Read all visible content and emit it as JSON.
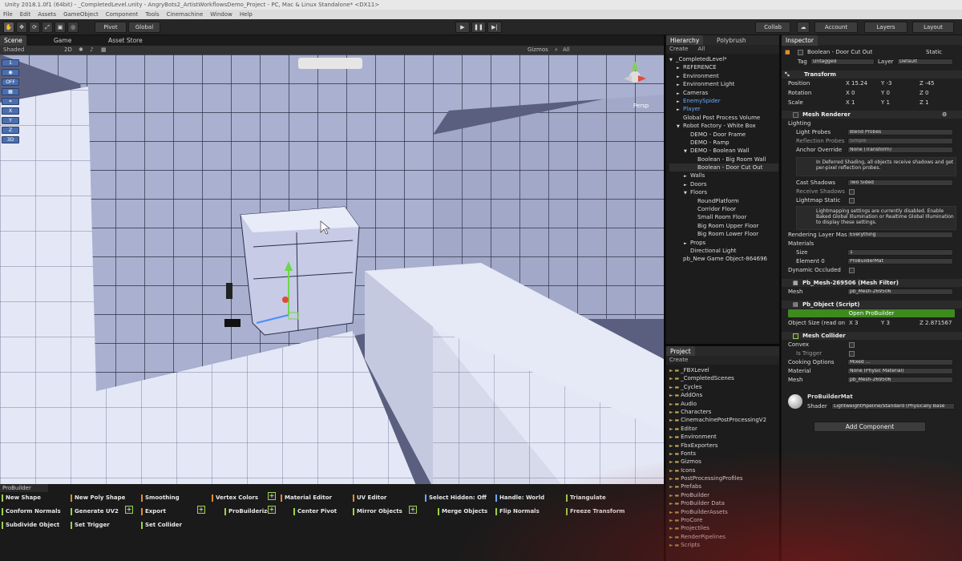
{
  "window": {
    "title": "Unity 2018.1.0f1 (64bit) - _CompletedLevel.unity - AngryBots2_ArtistWorkflowsDemo_Project - PC, Mac & Linux Standalone* <DX11>"
  },
  "menu": [
    "File",
    "Edit",
    "Assets",
    "GameObject",
    "Component",
    "Tools",
    "Cinemachine",
    "Window",
    "Help"
  ],
  "toolbar": {
    "pivot": "Pivot",
    "global": "Global",
    "collab": "Collab",
    "account": "Account",
    "layers": "Layers",
    "layout": "Layout"
  },
  "scene_panel": {
    "tabs": [
      "Scene",
      "Game",
      "Asset Store"
    ],
    "shading": "Shaded",
    "mode_2d": "2D",
    "gizmos": "Gizmos",
    "search": "All",
    "persp": "Persp",
    "tools": [
      "1",
      "",
      "OFF",
      "",
      "",
      "X",
      "Y",
      "Z",
      "3D"
    ]
  },
  "hierarchy": {
    "tabs": [
      "Hierarchy",
      "Polybrush"
    ],
    "create": "Create",
    "search": "All",
    "items": [
      {
        "label": "_CompletedLevel*",
        "indent": 0,
        "arrow": "▼"
      },
      {
        "label": "REFERENCE",
        "indent": 1,
        "arrow": "►"
      },
      {
        "label": "Environment",
        "indent": 1,
        "arrow": "►"
      },
      {
        "label": "Environment Light",
        "indent": 1,
        "arrow": "►"
      },
      {
        "label": "Cameras",
        "indent": 1,
        "arrow": "►"
      },
      {
        "label": "EnemySpider",
        "indent": 1,
        "arrow": "►",
        "style": "blue"
      },
      {
        "label": "Player",
        "indent": 1,
        "arrow": "►",
        "style": "blue"
      },
      {
        "label": "Global Post Process Volume",
        "indent": 1,
        "arrow": ""
      },
      {
        "label": "Robot Factory - White Box",
        "indent": 1,
        "arrow": "▼"
      },
      {
        "label": "DEMO - Door Frame",
        "indent": 2,
        "arrow": ""
      },
      {
        "label": "DEMO - Ramp",
        "indent": 2,
        "arrow": ""
      },
      {
        "label": "DEMO - Boolean Wall",
        "indent": 2,
        "arrow": "▼"
      },
      {
        "label": "Boolean - Big Room Wall",
        "indent": 3,
        "arrow": ""
      },
      {
        "label": "Boolean - Door Cut Out",
        "indent": 3,
        "arrow": "",
        "style": "sel"
      },
      {
        "label": "Walls",
        "indent": 2,
        "arrow": "►"
      },
      {
        "label": "Doors",
        "indent": 2,
        "arrow": "►"
      },
      {
        "label": "Floors",
        "indent": 2,
        "arrow": "▼"
      },
      {
        "label": "RoundPlatform",
        "indent": 3,
        "arrow": ""
      },
      {
        "label": "Corridor Floor",
        "indent": 3,
        "arrow": ""
      },
      {
        "label": "Small Room Floor",
        "indent": 3,
        "arrow": ""
      },
      {
        "label": "Big Room Upper Floor",
        "indent": 3,
        "arrow": ""
      },
      {
        "label": "Big Room Lower Floor",
        "indent": 3,
        "arrow": ""
      },
      {
        "label": "Props",
        "indent": 2,
        "arrow": "►"
      },
      {
        "label": "Directional Light",
        "indent": 2,
        "arrow": ""
      },
      {
        "label": "pb_New Game Object-864696",
        "indent": 1,
        "arrow": ""
      }
    ]
  },
  "project": {
    "tab": "Project",
    "create": "Create",
    "folders": [
      "_FBXLevel",
      "_CompletedScenes",
      "_Cycles",
      "AddOns",
      "Audio",
      "Characters",
      "CinemachinePostProcessingV2",
      "Editor",
      "Environment",
      "FbxExporters",
      "Fonts",
      "Gizmos",
      "Icons",
      "PostProcessingProfiles",
      "Prefabs",
      "ProBuilder",
      "ProBuilder Data",
      "ProBuilderAssets",
      "ProCore",
      "Projectiles",
      "RenderPipelines",
      "Scripts"
    ]
  },
  "inspector": {
    "tab": "Inspector",
    "object_name": "Boolean - Door Cut Out",
    "static": "Static",
    "tag_label": "Tag",
    "tag_value": "Untagged",
    "layer_label": "Layer",
    "layer_value": "Default",
    "transform": {
      "header": "Transform",
      "position_label": "Position",
      "px": "X 15.24",
      "py": "Y -3",
      "pz": "Z -45",
      "rotation_label": "Rotation",
      "rx": "X 0",
      "ry": "Y 0",
      "rz": "Z 0",
      "scale_label": "Scale",
      "sx": "X 1",
      "sy": "Y 1",
      "sz": "Z 1"
    },
    "mesh_renderer": {
      "header": "Mesh Renderer",
      "lighting": "Lighting",
      "light_probes_label": "Light Probes",
      "light_probes_value": "Blend Probes",
      "reflection_probes_label": "Reflection Probes",
      "reflection_probes_value": "Simple",
      "anchor_label": "Anchor Override",
      "anchor_value": "None (Transform)",
      "deferred_note": "In Deferred Shading, all objects receive shadows and get per-pixel reflection probes.",
      "cast_shadows_label": "Cast Shadows",
      "cast_shadows_value": "Two Sided",
      "receive_shadows_label": "Receive Shadows",
      "lightmap_static_label": "Lightmap Static",
      "lightmap_note": "Lightmapping settings are currently disabled. Enable Baked Global Illumination or Realtime Global Illumination to display these settings.",
      "rendering_layer_label": "Rendering Layer Mas",
      "rendering_layer_value": "Everything",
      "materials_label": "Materials",
      "size_label": "Size",
      "size_value": "1",
      "element0_label": "Element 0",
      "element0_value": "ProBuilderMat",
      "dynamic_occluded_label": "Dynamic Occluded"
    },
    "mesh_filter": {
      "header": "Pb_Mesh-269506 (Mesh Filter)",
      "mesh_label": "Mesh",
      "mesh_value": "pb_Mesh-269506"
    },
    "pb_object": {
      "header": "Pb_Object (Script)",
      "open_button": "Open ProBuilder",
      "size_label": "Object Size (read on",
      "sx": "X 3",
      "sy": "Y 3",
      "sz": "Z 2.871567"
    },
    "mesh_collider": {
      "header": "Mesh Collider",
      "convex_label": "Convex",
      "is_trigger_label": "Is Trigger",
      "cooking_label": "Cooking Options",
      "cooking_value": "Mixed ...",
      "material_label": "Material",
      "material_value": "None (Physic Material)",
      "mesh_label": "Mesh",
      "mesh_value": "pb_Mesh-269506"
    },
    "material": {
      "name": "ProBuilderMat",
      "shader_label": "Shader",
      "shader_value": "LightweightPipeline/Standard (Physically Base"
    },
    "add_component": "Add Component"
  },
  "probuilder": {
    "title": "ProBuilder",
    "columns": [
      [
        {
          "label": "New Shape",
          "color": "#9bd24a"
        },
        {
          "label": "Conform Normals",
          "color": "#9bd24a"
        },
        {
          "label": "Subdivide Object",
          "color": "#9bd24a"
        }
      ],
      [
        {
          "label": "New Poly Shape",
          "color": "#e98a2a"
        },
        {
          "label": "Generate UV2",
          "color": "#9bd24a"
        },
        {
          "label": "Set Trigger",
          "color": "#9bd24a"
        }
      ],
      [
        {
          "label": "Smoothing",
          "color": "#e98a2a"
        },
        {
          "label": "Export",
          "color": "#e98a2a"
        },
        {
          "label": "Set Collider",
          "color": "#9bd24a"
        }
      ],
      [
        {
          "label": "Vertex Colors",
          "color": "#e98a2a"
        },
        {
          "label": "ProBuilderize",
          "color": "#9bd24a"
        }
      ],
      [
        {
          "label": "Material Editor",
          "color": "#e98a2a"
        },
        {
          "label": "Center Pivot",
          "color": "#9bd24a"
        }
      ],
      [
        {
          "label": "UV Editor",
          "color": "#e98a2a"
        },
        {
          "label": "Mirror Objects",
          "color": "#9bd24a"
        }
      ],
      [
        {
          "label": "Select Hidden: Off",
          "color": "#6aa8ff"
        },
        {
          "label": "Merge Objects",
          "color": "#9bd24a"
        }
      ],
      [
        {
          "label": "Handle: World",
          "color": "#6aa8ff"
        },
        {
          "label": "Flip Normals",
          "color": "#9bd24a"
        }
      ],
      [
        {
          "label": "Triangulate",
          "color": "#9bd24a"
        },
        {
          "label": "Freeze Transform",
          "color": "#9bd24a"
        }
      ]
    ]
  }
}
